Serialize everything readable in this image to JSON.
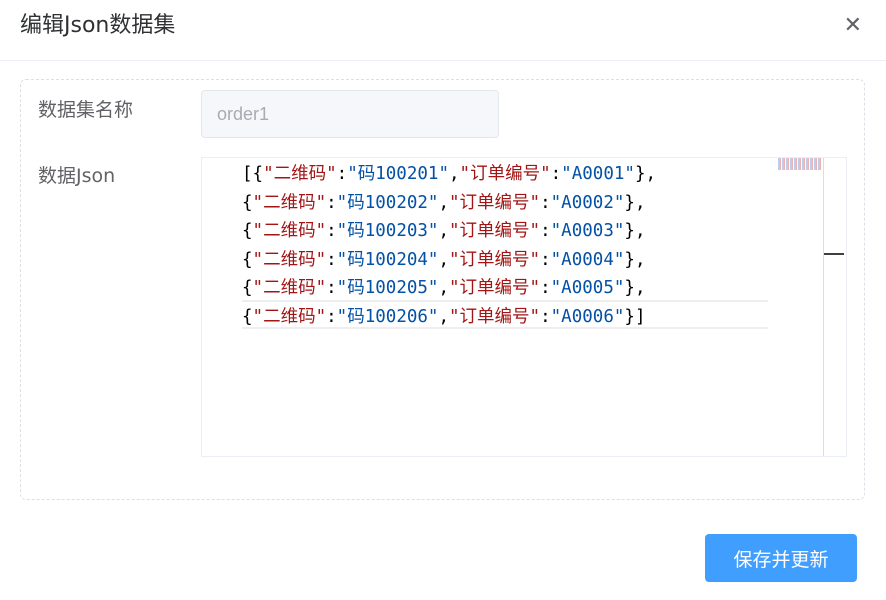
{
  "dialog": {
    "title": "编辑Json数据集",
    "close_glyph": "✕"
  },
  "form": {
    "name_label": "数据集名称",
    "name_value": "order1",
    "json_label": "数据Json"
  },
  "editor": {
    "lines": [
      {
        "open": "[{",
        "k1": "\"二维码\"",
        "colon1": ":",
        "v1": "\"码100201\"",
        "comma": ",",
        "k2": "\"订单编号\"",
        "colon2": ":",
        "v2": "\"A0001\"",
        "close": "},"
      },
      {
        "open": "{",
        "k1": "\"二维码\"",
        "colon1": ":",
        "v1": "\"码100202\"",
        "comma": ",",
        "k2": "\"订单编号\"",
        "colon2": ":",
        "v2": "\"A0002\"",
        "close": "},"
      },
      {
        "open": "{",
        "k1": "\"二维码\"",
        "colon1": ":",
        "v1": "\"码100203\"",
        "comma": ",",
        "k2": "\"订单编号\"",
        "colon2": ":",
        "v2": "\"A0003\"",
        "close": "},"
      },
      {
        "open": "{",
        "k1": "\"二维码\"",
        "colon1": ":",
        "v1": "\"码100204\"",
        "comma": ",",
        "k2": "\"订单编号\"",
        "colon2": ":",
        "v2": "\"A0004\"",
        "close": "},"
      },
      {
        "open": "{",
        "k1": "\"二维码\"",
        "colon1": ":",
        "v1": "\"码100205\"",
        "comma": ",",
        "k2": "\"订单编号\"",
        "colon2": ":",
        "v2": "\"A0005\"",
        "close": "},"
      },
      {
        "open": "{",
        "k1": "\"二维码\"",
        "colon1": ":",
        "v1": "\"码100206\"",
        "comma": ",",
        "k2": "\"订单编号\"",
        "colon2": ":",
        "v2": "\"A0006\"",
        "close": "}]"
      }
    ],
    "key_color": "#a31515",
    "value_color": "#0451a5"
  },
  "footer": {
    "save_label": "保存并更新",
    "accent": "#409eff"
  }
}
